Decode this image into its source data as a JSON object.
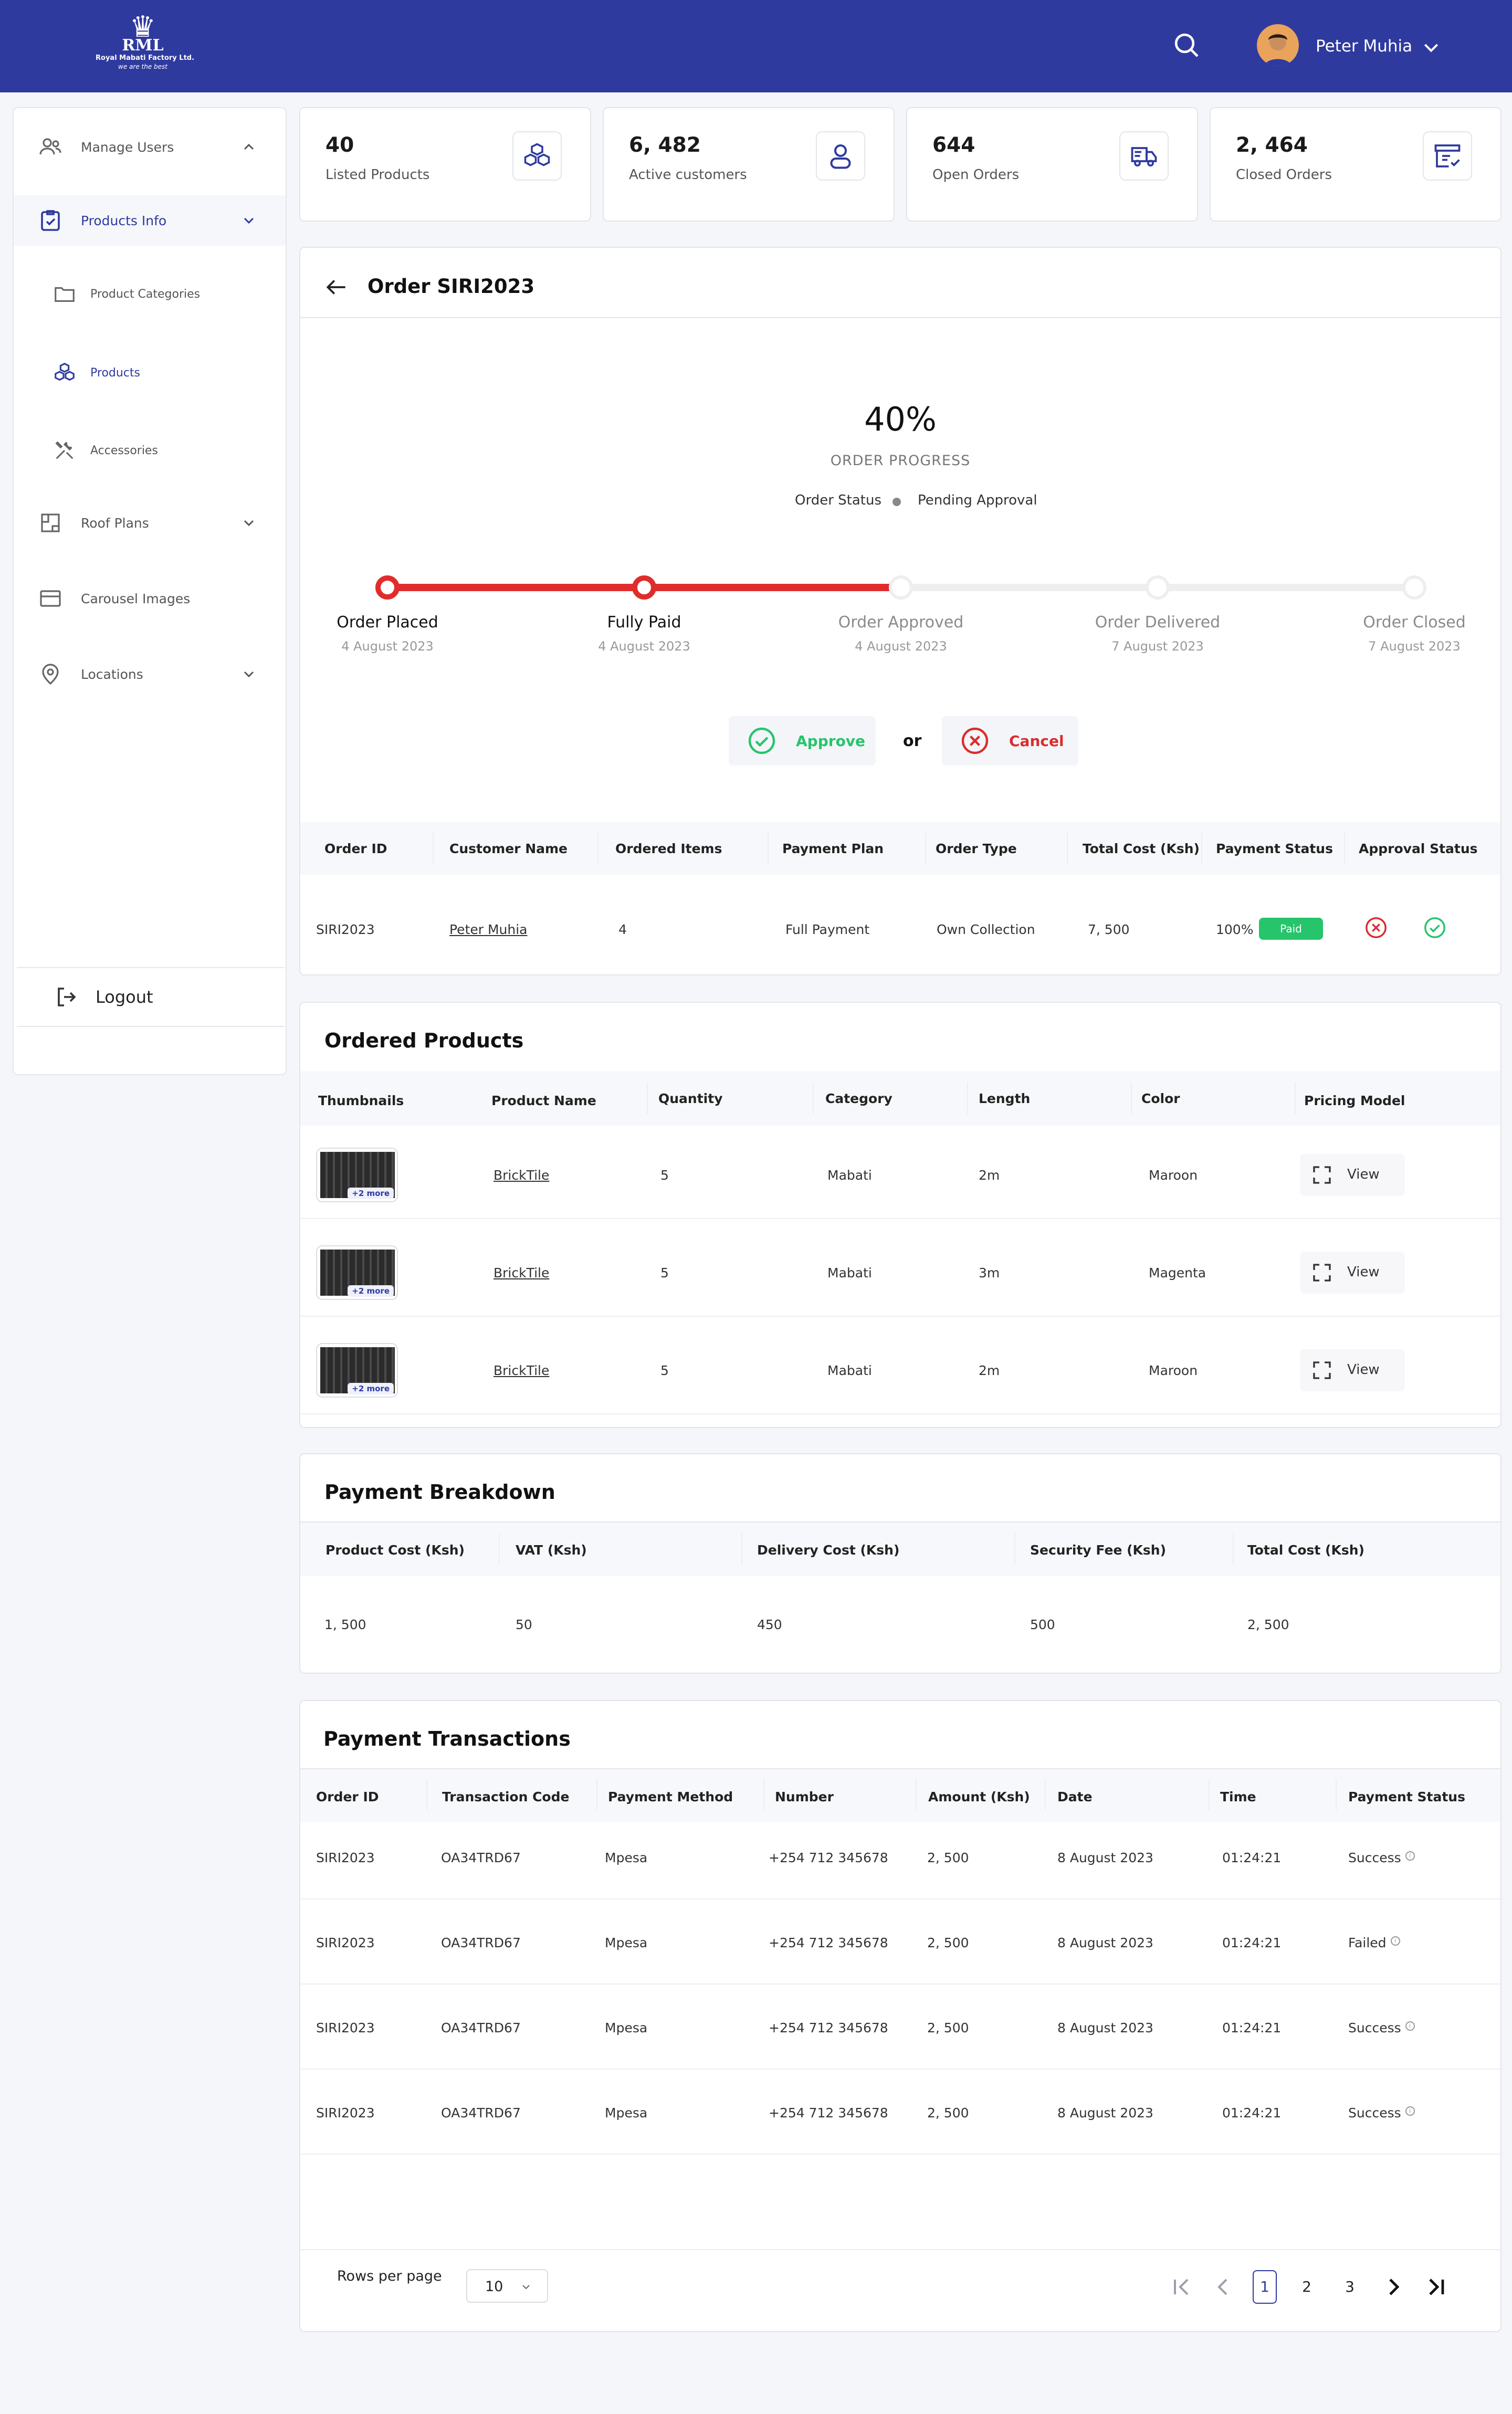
{
  "header": {
    "logo": {
      "abbr": "RML",
      "name": "Royal Mabati Factory Ltd.",
      "tagline": "we are the best"
    },
    "user_name": "Peter Muhia",
    "icons": {
      "search": "search-icon",
      "dropdown": "chevron-down-icon"
    }
  },
  "sidebar": {
    "items": [
      {
        "label": "Manage Users",
        "icon": "users-icon"
      },
      {
        "label": "Products Info",
        "icon": "clipboard-check-icon"
      },
      {
        "label": "Product Categories",
        "icon": "folder-icon"
      },
      {
        "label": "Products",
        "icon": "cubes-icon"
      },
      {
        "label": "Accessories",
        "icon": "tools-icon"
      },
      {
        "label": "Roof Plans",
        "icon": "floor-plan-icon"
      },
      {
        "label": "Carousel Images",
        "icon": "image-carousel-icon"
      },
      {
        "label": "Locations",
        "icon": "location-pin-icon"
      }
    ],
    "logout": "Logout"
  },
  "stats": [
    {
      "value": "40",
      "label": "Listed Products",
      "icon": "cubes-icon"
    },
    {
      "value": "6, 482",
      "label": "Active customers",
      "icon": "user-icon"
    },
    {
      "value": "644",
      "label": "Open Orders",
      "icon": "delivery-truck-icon"
    },
    {
      "value": "2, 464",
      "label": "Closed Orders",
      "icon": "closed-box-icon"
    }
  ],
  "order": {
    "title": "Order SIRI2023",
    "progress_value": "40%",
    "progress_fraction": 0.4,
    "progress_label": "ORDER PROGRESS",
    "status_label": "Order Status",
    "status_value": "Pending Approval",
    "steps": [
      {
        "label": "Order Placed",
        "date": "4 August 2023",
        "done": true
      },
      {
        "label": "Fully Paid",
        "date": "4 August 2023",
        "done": true
      },
      {
        "label": "Order Approved",
        "date": "4 August 2023",
        "done": false
      },
      {
        "label": "Order Delivered",
        "date": "7 August 2023",
        "done": false
      },
      {
        "label": "Order Closed",
        "date": "7 August 2023",
        "done": false
      }
    ],
    "approve_label": "Approve",
    "or_label": "or",
    "cancel_label": "Cancel",
    "table": {
      "headers": [
        "Order ID",
        "Customer Name",
        "Ordered Items",
        "Payment Plan",
        "Order Type",
        "Total Cost (Ksh)",
        "Payment Status",
        "Approval Status"
      ],
      "row": {
        "order_id": "SIRI2023",
        "customer": "Peter Muhia",
        "items": "4",
        "plan": "Full Payment",
        "type": "Own Collection",
        "total": "7, 500",
        "paid_pct": "100%",
        "status_badge": "Paid"
      }
    }
  },
  "ordered_products": {
    "title": "Ordered Products",
    "headers": [
      "Thumbnails",
      "Product Name",
      "Quantity",
      "Category",
      "Length",
      "Color",
      "Pricing Model"
    ],
    "rows": [
      {
        "more": "+2 more",
        "name": "BrickTile",
        "qty": "5",
        "category": "Mabati",
        "length": "2m",
        "color": "Maroon",
        "action": "View"
      },
      {
        "more": "+2 more",
        "name": "BrickTile",
        "qty": "5",
        "category": "Mabati",
        "length": "3m",
        "color": "Magenta",
        "action": "View"
      },
      {
        "more": "+2 more",
        "name": "BrickTile",
        "qty": "5",
        "category": "Mabati",
        "length": "2m",
        "color": "Maroon",
        "action": "View"
      }
    ]
  },
  "payment_breakdown": {
    "title": "Payment Breakdown",
    "headers": [
      "Product Cost (Ksh)",
      "VAT (Ksh)",
      "Delivery Cost (Ksh)",
      "Security Fee (Ksh)",
      "Total Cost (Ksh)"
    ],
    "values": [
      "1, 500",
      "50",
      "450",
      "500",
      "2, 500"
    ]
  },
  "transactions": {
    "title": "Payment Transactions",
    "headers": [
      "Order ID",
      "Transaction Code",
      "Payment Method",
      "Number",
      "Amount  (Ksh)",
      "Date",
      "Time",
      "Payment Status"
    ],
    "rows": [
      {
        "id": "SIRI2023",
        "code": "OA34TRD67",
        "method": "Mpesa",
        "number": "+254 712 345678",
        "amount": "2, 500",
        "date": "8 August 2023",
        "time": "01:24:21",
        "status": "Success"
      },
      {
        "id": "SIRI2023",
        "code": "OA34TRD67",
        "method": "Mpesa",
        "number": "+254 712 345678",
        "amount": "2, 500",
        "date": "8 August 2023",
        "time": "01:24:21",
        "status": "Failed"
      },
      {
        "id": "SIRI2023",
        "code": "OA34TRD67",
        "method": "Mpesa",
        "number": "+254 712 345678",
        "amount": "2, 500",
        "date": "8 August 2023",
        "time": "01:24:21",
        "status": "Success"
      },
      {
        "id": "SIRI2023",
        "code": "OA34TRD67",
        "method": "Mpesa",
        "number": "+254 712 345678",
        "amount": "2, 500",
        "date": "8 August 2023",
        "time": "01:24:21",
        "status": "Success"
      }
    ],
    "rows_per_page_label": "Rows per page",
    "rows_per_page_value": "10",
    "pages": [
      "1",
      "2",
      "3"
    ],
    "current_page": "1"
  },
  "colors": {
    "primary": "#2f3a9f",
    "progress": "#e02c2c",
    "success": "#26c46b",
    "cancel": "#d92d2d"
  }
}
